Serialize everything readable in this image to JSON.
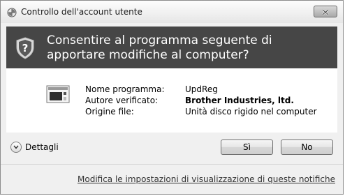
{
  "window": {
    "title": "Controllo dell'account utente",
    "close_icon": "close-icon"
  },
  "header": {
    "question": "Consentire al programma seguente di apportare modifiche al computer?",
    "icon": "shield-question-icon"
  },
  "details": {
    "program_icon": "program-window-icon",
    "rows": [
      {
        "label": "Nome programma:",
        "value": "UpdReg"
      },
      {
        "label": "Autore verificato:",
        "value": "Brother Industries, ltd."
      },
      {
        "label": "Origine file:",
        "value": "Unità disco rigido nel computer"
      }
    ]
  },
  "footer": {
    "details_toggle": "Dettagli",
    "yes_label": "Sì",
    "no_label": "No",
    "settings_link": "Modifica le impostazioni di visualizzazione di queste notifiche"
  },
  "colors": {
    "header_bg": "#464646",
    "dialog_bg": "#f0f0f0",
    "body_bg": "#ffffff"
  }
}
